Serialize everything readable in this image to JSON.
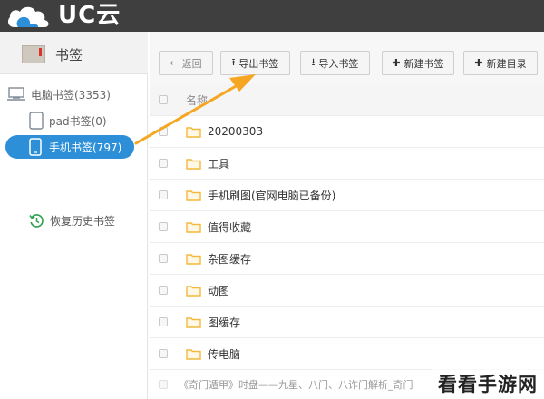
{
  "app": {
    "logo_text": "UC云"
  },
  "sidebar": {
    "title": "书签",
    "devices": [
      {
        "label": "电脑书签(3353)",
        "icon": "monitor-icon"
      },
      {
        "label": "pad书签(0)",
        "icon": "tablet-icon"
      },
      {
        "label": "手机书签(797)",
        "icon": "phone-icon",
        "active": true
      }
    ],
    "restore_label": "恢复历史书签"
  },
  "toolbar": {
    "back": "返回",
    "export": "导出书签",
    "import": "导入书签",
    "new_bookmark": "新建书签",
    "new_folder": "新建目录"
  },
  "list": {
    "header": "名称",
    "rows": [
      "20200303",
      "工具",
      "手机刷图(官网电脑已备份)",
      "值得收藏",
      "杂图缓存",
      "动图",
      "图缓存",
      "传电脑"
    ],
    "partial_row": "《奇门遁甲》时盘——九星、八门、八诈门解析_奇门"
  },
  "watermark": "看看手游网",
  "colors": {
    "topbar": "#3f3f3f",
    "active_blue": "#2d8fd8",
    "arrow": "#f5a623",
    "folder": "#f2b93b"
  }
}
